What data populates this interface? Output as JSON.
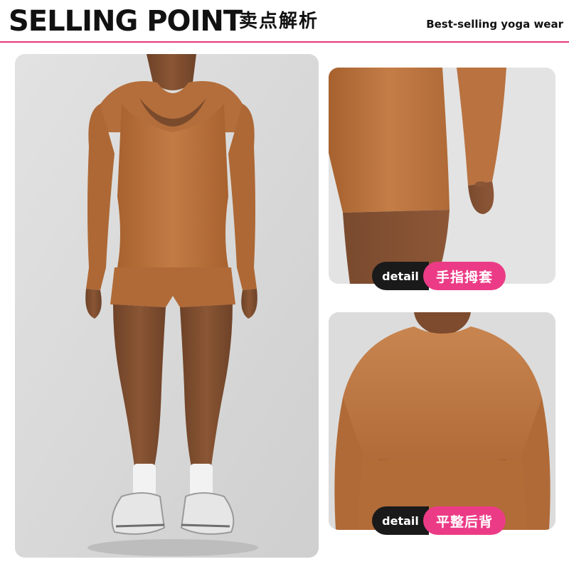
{
  "header": {
    "title_en": "SELLING POINT",
    "title_cn": "卖点解析",
    "tagline": "Best-selling yoga wear",
    "accent_color": "#e8357d"
  },
  "main_image": {
    "garment_color": "#b9733f",
    "background_color": "#dadada"
  },
  "details": [
    {
      "tag_label": "detail",
      "feature": "手指拇套"
    },
    {
      "tag_label": "detail",
      "feature": "平整后背"
    }
  ],
  "colors": {
    "tag_dark": "#1a1a1a",
    "tag_pink": "#ec3b86"
  }
}
